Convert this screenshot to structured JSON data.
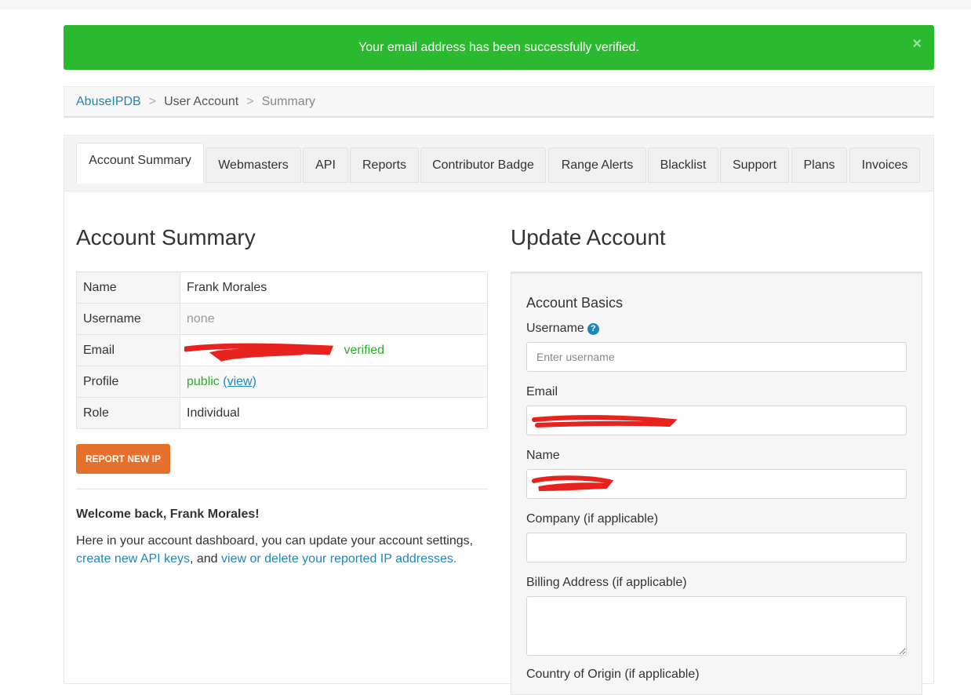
{
  "alert": {
    "message": "Your email address has been successfully verified.",
    "close_glyph": "×"
  },
  "breadcrumb": {
    "home": "AbuseIPDB",
    "separator": ">",
    "section": "User Account",
    "current": "Summary"
  },
  "tabs": [
    {
      "label": "Account Summary",
      "active": true
    },
    {
      "label": "Webmasters"
    },
    {
      "label": "API"
    },
    {
      "label": "Reports"
    },
    {
      "label": "Contributor Badge"
    },
    {
      "label": "Range Alerts"
    },
    {
      "label": "Blacklist"
    },
    {
      "label": "Support"
    },
    {
      "label": "Plans"
    },
    {
      "label": "Invoices"
    }
  ],
  "summary": {
    "title": "Account Summary",
    "rows": {
      "name": {
        "label": "Name",
        "value": "Frank Morales"
      },
      "username": {
        "label": "Username",
        "value": "none"
      },
      "email": {
        "label": "Email",
        "value": "",
        "status": "verified"
      },
      "profile": {
        "label": "Profile",
        "value": "public",
        "link": "(view)"
      },
      "role": {
        "label": "Role",
        "value": "Individual"
      }
    },
    "report_button": "REPORT NEW IP",
    "welcome": "Welcome back, Frank Morales!",
    "intro_text": "Here in your account dashboard, you can update your account settings,",
    "intro_link1": "create new API keys",
    "intro_mid": ", and",
    "intro_link2": "view or delete your reported IP addresses",
    "intro_end": "."
  },
  "update": {
    "title": "Update Account",
    "section": "Account Basics",
    "username_label": "Username",
    "username_placeholder": "Enter username",
    "email_label": "Email",
    "name_label": "Name",
    "company_label": "Company (if applicable)",
    "billing_label": "Billing Address (if applicable)",
    "country_label": "Country of Origin (if applicable)"
  },
  "colors": {
    "alert_bg": "#2bb930",
    "link": "#1f87b8",
    "button": "#e5702b",
    "verified": "#2baa2b",
    "redaction": "#e8231f"
  }
}
